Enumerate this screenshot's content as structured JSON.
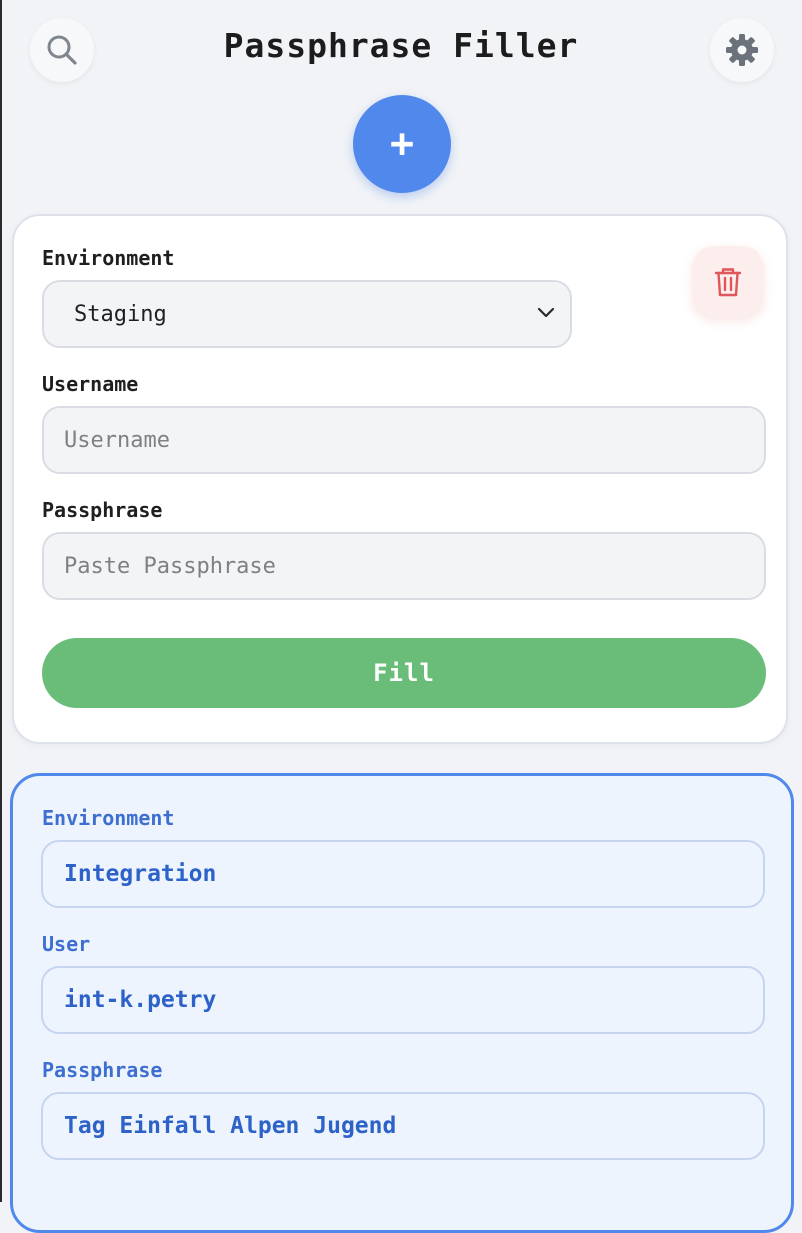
{
  "header": {
    "title": "Passphrase Filler",
    "search_icon": "search-icon",
    "settings_icon": "gear-icon",
    "add_label": "+"
  },
  "form": {
    "environment_label": "Environment",
    "environment_value": "Staging",
    "username_label": "Username",
    "username_value": "",
    "username_placeholder": "Username",
    "passphrase_label": "Passphrase",
    "passphrase_value": "",
    "passphrase_placeholder": "Paste Passphrase",
    "fill_label": "Fill",
    "delete_icon": "trash-icon"
  },
  "entry": {
    "environment_label": "Environment",
    "environment_value": "Integration",
    "user_label": "User",
    "user_value": "int-k.petry",
    "passphrase_label": "Passphrase",
    "passphrase_value": "Tag Einfall Alpen Jugend"
  },
  "colors": {
    "accent": "#5088ec",
    "fill_button": "#69bd78",
    "delete": "#e0575b",
    "entry_text": "#2d62c8"
  }
}
